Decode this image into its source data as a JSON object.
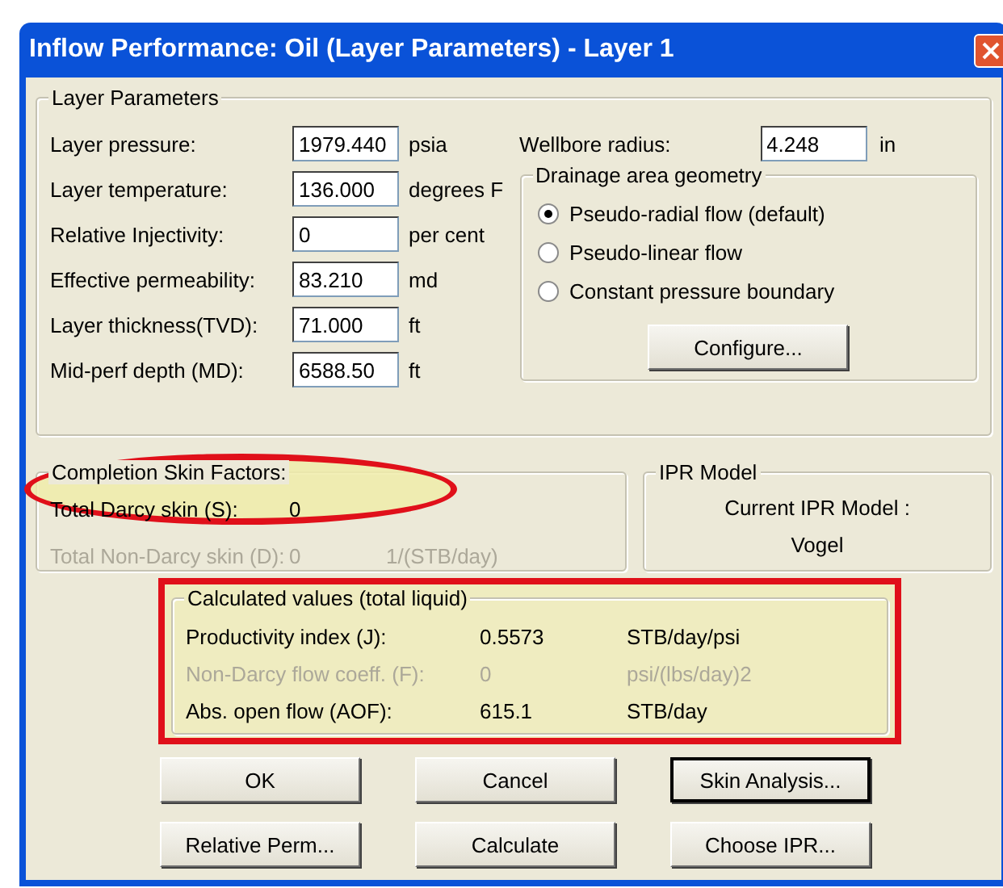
{
  "window": {
    "title": "Inflow Performance: Oil (Layer Parameters) - Layer 1"
  },
  "layer_parameters": {
    "title": "Layer Parameters",
    "fields": [
      {
        "label": "Layer pressure:",
        "value": "1979.440",
        "unit": "psia"
      },
      {
        "label": "Layer temperature:",
        "value": "136.000",
        "unit": "degrees F"
      },
      {
        "label": "Relative Injectivity:",
        "value": "0",
        "unit": "per cent"
      },
      {
        "label": "Effective permeability:",
        "value": "83.210",
        "unit": "md"
      },
      {
        "label": "Layer thickness(TVD):",
        "value": "71.000",
        "unit": "ft"
      },
      {
        "label": "Mid-perf depth (MD):",
        "value": "6588.50",
        "unit": "ft"
      }
    ],
    "wellbore_radius": {
      "label": "Wellbore radius:",
      "value": "4.248",
      "unit": "in"
    },
    "drainage_area_geometry": {
      "title": "Drainage area geometry",
      "options": [
        {
          "label": "Pseudo-radial flow (default)",
          "selected": true
        },
        {
          "label": "Pseudo-linear flow",
          "selected": false
        },
        {
          "label": "Constant pressure boundary",
          "selected": false
        }
      ],
      "configure_button": "Configure..."
    }
  },
  "completion_skin_factors": {
    "title": "Completion Skin Factors:",
    "highlighted": true,
    "rows": [
      {
        "label": "Total Darcy skin (S):",
        "value": "0",
        "disabled": false
      },
      {
        "label": "Total Non-Darcy skin (D):",
        "value": "0",
        "unit": "1/(STB/day)",
        "disabled": true
      }
    ]
  },
  "ipr_model": {
    "title": "IPR Model",
    "label": "Current IPR Model :",
    "value": "Vogel"
  },
  "calculated_values": {
    "title": "Calculated values (total liquid)",
    "highlighted": true,
    "rows": [
      {
        "label": "Productivity index (J):",
        "value": "0.5573",
        "unit": "STB/day/psi",
        "disabled": false
      },
      {
        "label": "Non-Darcy flow coeff. (F):",
        "value": "0",
        "unit": "psi/(lbs/day)2",
        "disabled": true
      },
      {
        "label": "Abs. open flow (AOF):",
        "value": "615.1",
        "unit": "STB/day",
        "disabled": false
      }
    ]
  },
  "buttons": [
    {
      "label": "OK",
      "default": false
    },
    {
      "label": "Cancel",
      "default": false
    },
    {
      "label": "Skin Analysis...",
      "default": true
    },
    {
      "label": "Relative Perm...",
      "default": false
    },
    {
      "label": "Calculate",
      "default": false
    },
    {
      "label": "Choose IPR...",
      "default": false
    }
  ]
}
